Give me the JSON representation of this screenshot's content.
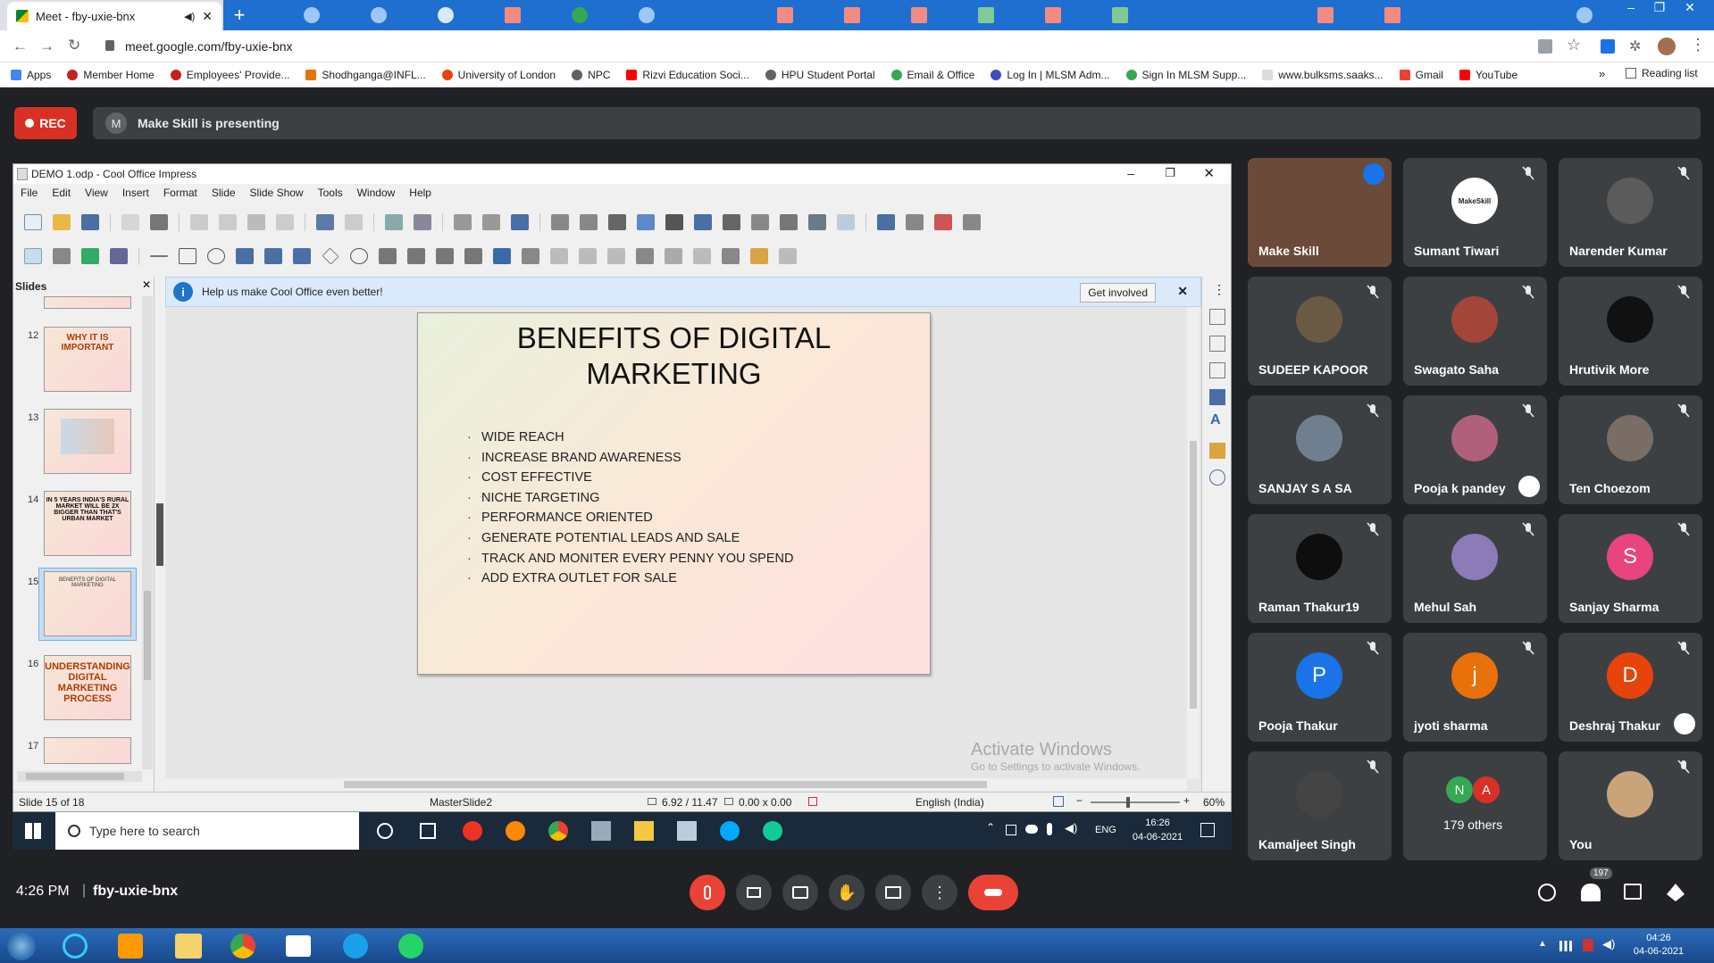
{
  "browser": {
    "tab_title": "Meet - fby-uxie-bnx",
    "url": "meet.google.com/fby-uxie-bnx",
    "bookmarks": [
      {
        "label": "Apps"
      },
      {
        "label": "Member Home"
      },
      {
        "label": "Employees' Provide..."
      },
      {
        "label": "Shodhganga@INFL..."
      },
      {
        "label": "University of London"
      },
      {
        "label": "NPC"
      },
      {
        "label": "Rizvi Education Soci..."
      },
      {
        "label": "HPU Student Portal"
      },
      {
        "label": "Email & Office"
      },
      {
        "label": "Log In | MLSM Adm..."
      },
      {
        "label": "Sign In MLSM Supp..."
      },
      {
        "label": "www.bulksms.saaks..."
      },
      {
        "label": "Gmail"
      },
      {
        "label": "YouTube"
      }
    ],
    "reading_list": "Reading list",
    "more_bookmarks": "»"
  },
  "meet": {
    "rec_label": "REC",
    "presenter_initial": "M",
    "presenting_text": "Make Skill is presenting",
    "time": "4:26 PM",
    "separator": "|",
    "meeting_code": "fby-uxie-bnx",
    "participant_count_badge": "197"
  },
  "impress": {
    "window_title": "DEMO 1.odp - Cool Office Impress",
    "menu": [
      "File",
      "Edit",
      "View",
      "Insert",
      "Format",
      "Slide",
      "Slide Show",
      "Tools",
      "Window",
      "Help"
    ],
    "slides_pane_title": "Slides",
    "thumbs": [
      {
        "num": "12",
        "text": "WHY IT IS IMPORTANT"
      },
      {
        "num": "13",
        "text": ""
      },
      {
        "num": "14",
        "text": "IN 5 YEARS INDIA'S RURAL MARKET WILL BE 2X BIGGER THAN THAT'S URBAN MARKET"
      },
      {
        "num": "15",
        "text": "BENEFITS OF DIGITAL MARKETING"
      },
      {
        "num": "16",
        "text": "UNDERSTANDING DIGITAL MARKETING PROCESS"
      },
      {
        "num": "17",
        "text": ""
      }
    ],
    "infobar_text": "Help us make Cool Office even better!",
    "infobar_icon": "i",
    "get_involved": "Get involved",
    "slide": {
      "title_line1": "BENEFITS OF DIGITAL",
      "title_line2": "MARKETING",
      "bullets": [
        "WIDE REACH",
        "INCREASE BRAND AWARENESS",
        "COST EFFECTIVE",
        "NICHE TARGETING",
        "PERFORMANCE ORIENTED",
        "GENERATE POTENTIAL LEADS AND SALE",
        "TRACK AND MONITER EVERY PENNY YOU SPEND",
        "ADD EXTRA OUTLET FOR SALE"
      ]
    },
    "activate_title": "Activate Windows",
    "activate_sub": "Go to Settings to activate Windows.",
    "status": {
      "slide_count": "Slide 15 of 18",
      "master": "MasterSlide2",
      "position": "6.92 / 11.47",
      "size": "0.00 x 0.00",
      "language": "English (India)",
      "zoom": "60%"
    }
  },
  "win_taskbar": {
    "search_placeholder": "Type here to search",
    "lang": "ENG",
    "time": "16:26",
    "date": "04-06-2021"
  },
  "host_taskbar": {
    "time": "04:26",
    "date": "04-06-2021"
  },
  "participants": [
    {
      "name": "Make Skill",
      "initial": "",
      "color": "#6b4a3a",
      "speaking": true
    },
    {
      "name": "Sumant Tiwari",
      "initial": "MakeSkill",
      "color": "#ffffff"
    },
    {
      "name": "Narender Kumar",
      "initial": "",
      "color": "#5b5b5b"
    },
    {
      "name": "SUDEEP KAPOOR",
      "initial": "",
      "color": "#6a5a44"
    },
    {
      "name": "Swagato Saha",
      "initial": "",
      "color": "#a4453a"
    },
    {
      "name": "Hrutivik More",
      "initial": "",
      "color": "#111111"
    },
    {
      "name": "SANJAY S A SA",
      "initial": "",
      "color": "#6f7f8f"
    },
    {
      "name": "Pooja k pandey",
      "initial": "",
      "color": "#b0607a"
    },
    {
      "name": "Ten Choezom",
      "initial": "",
      "color": "#7a6d66"
    },
    {
      "name": "Raman Thakur19",
      "initial": "",
      "color": "#0e0e0e"
    },
    {
      "name": "Mehul Sah",
      "initial": "",
      "color": "#8d7ab8"
    },
    {
      "name": "Sanjay Sharma",
      "initial": "S",
      "color": "#e8457e"
    },
    {
      "name": "Pooja Thakur",
      "initial": "P",
      "color": "#1a73e8"
    },
    {
      "name": "jyoti sharma",
      "initial": "j",
      "color": "#e8710a"
    },
    {
      "name": "Deshraj Thakur",
      "initial": "D",
      "color": "#e8430a"
    },
    {
      "name": "Kamaljeet Singh",
      "initial": "",
      "color": "#444444"
    },
    {
      "name": "179 others",
      "initial": "",
      "color": "#3c4043",
      "others": [
        "N",
        "A"
      ]
    },
    {
      "name": "You",
      "initial": "",
      "color": "#c9a37a"
    }
  ]
}
